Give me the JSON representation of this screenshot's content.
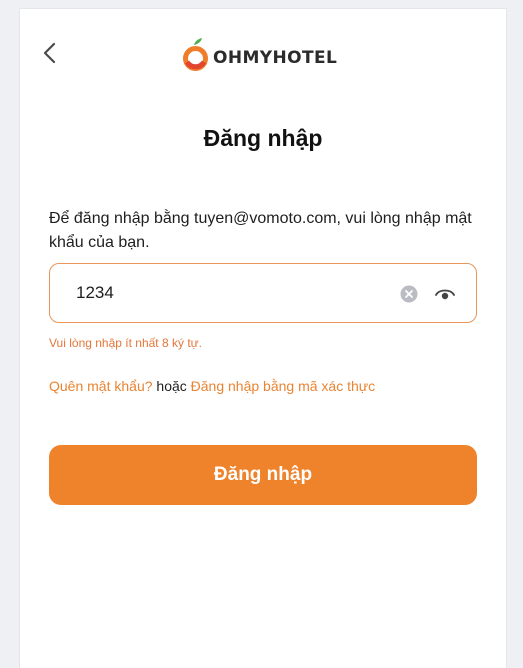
{
  "header": {
    "back_icon": "chevron-left-icon",
    "brand_name": "OHMYHOTEL"
  },
  "login": {
    "title": "Đăng nhập",
    "description": "Để đăng nhập bằng tuyen@vomoto.com, vui lòng nhập mật khẩu của bạn.",
    "password_value": "1234",
    "clear_icon": "clear-icon",
    "toggle_icon": "eye-icon",
    "error_message": "Vui lòng nhập ít nhất 8 ký tự.",
    "forgot_password": "Quên mật khẩu?",
    "or_text": "hoặc",
    "code_login": "Đăng nhập bằng mã xác thực",
    "submit_label": "Đăng nhập"
  },
  "colors": {
    "accent": "#ef832c",
    "field_border": "#e8965a",
    "error": "#e4763a"
  }
}
